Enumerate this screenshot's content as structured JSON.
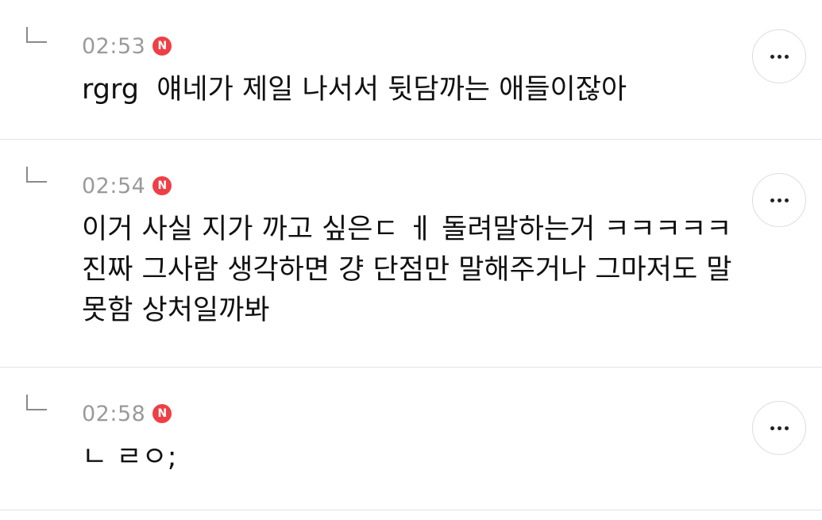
{
  "replies": [
    {
      "time": "02:53",
      "badge": "N",
      "text": "rgrg  얘네가 제일 나서서 뒷담까는 애들이잖아"
    },
    {
      "time": "02:54",
      "badge": "N",
      "text": "이거 사실 지가 까고 싶은ㄷ ㅔ 돌려말하는거 ㅋㅋㅋㅋㅋ 진짜 그사람 생각하면 걍 단점만 말해주거나 그마저도 말 못함 상처일까봐"
    },
    {
      "time": "02:58",
      "badge": "N",
      "text": "ㄴ ㄹㅇ;"
    }
  ],
  "icons": {
    "reply_arrow": "reply-arrow-icon",
    "new_badge": "new-badge-icon",
    "more": "more-options-icon"
  },
  "colors": {
    "badge": "#ef3f46",
    "time": "#9a9a9a",
    "divider": "#e3e3e3"
  }
}
